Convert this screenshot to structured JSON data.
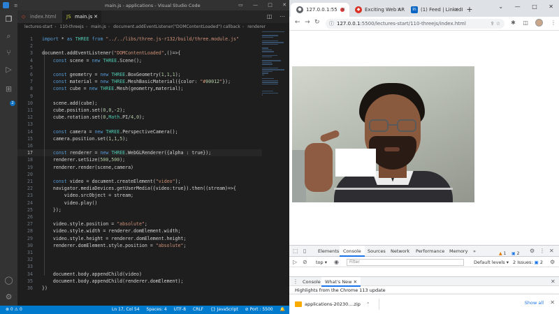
{
  "vscode": {
    "menu": "≡",
    "window_title": "main.js - applications - Visual Studio Code",
    "tabs": [
      {
        "label": "index.html",
        "icon": "html-file-icon"
      },
      {
        "label": "main.js",
        "icon": "js-file-icon"
      }
    ],
    "breadcrumb": [
      "lectures-start",
      "110-threejs",
      "main.js",
      "document.addEventListener(\"DOMContentLoaded\") callback",
      "renderer"
    ],
    "activity_badge": "2",
    "code_lines": [
      {
        "n": "1",
        "t": "import * as THREE from \"../../libs/three.js-r132/build/three.module.js\""
      },
      {
        "n": "2",
        "t": ""
      },
      {
        "n": "3",
        "t": "document.addEventListener(\"DOMContentLoaded\",()=>{"
      },
      {
        "n": "4",
        "t": "    const scene = new THREE.Scene();"
      },
      {
        "n": "5",
        "t": ""
      },
      {
        "n": "6",
        "t": "    const geometry = new THREE.BoxGeometry(1,1,1);"
      },
      {
        "n": "7",
        "t": "    const material = new THREE.MeshBasicMaterial({color: \"#00012\"});"
      },
      {
        "n": "8",
        "t": "    const cube = new THREE.Mesh(geometry,material);"
      },
      {
        "n": "9",
        "t": ""
      },
      {
        "n": "10",
        "t": "    scene.add(cube);"
      },
      {
        "n": "11",
        "t": "    cube.position.set(0,0,-2);"
      },
      {
        "n": "12",
        "t": "    cube.rotation.set(0,Math.PI/4,0);"
      },
      {
        "n": "13",
        "t": ""
      },
      {
        "n": "14",
        "t": "    const camera = new THREE.PerspectiveCamera();"
      },
      {
        "n": "15",
        "t": "    camera.position.set(1,1,5);"
      },
      {
        "n": "16",
        "t": ""
      },
      {
        "n": "17",
        "t": "    const renderer = new THREE.WebGLRenderer({alpha : true});"
      },
      {
        "n": "18",
        "t": "    renderer.setSize(500,500);"
      },
      {
        "n": "19",
        "t": "    renderer.render(scene,camera)"
      },
      {
        "n": "20",
        "t": ""
      },
      {
        "n": "21",
        "t": "    const video = document.createElement(\"video\");"
      },
      {
        "n": "22",
        "t": "    navigator.mediaDevices.getUserMedia({video:true}).then((stream)=>{"
      },
      {
        "n": "23",
        "t": "        video.srcObject = stream;"
      },
      {
        "n": "24",
        "t": "        video.play()"
      },
      {
        "n": "25",
        "t": "    });"
      },
      {
        "n": "26",
        "t": ""
      },
      {
        "n": "27",
        "t": "    video.style.position = \"absolute\";"
      },
      {
        "n": "28",
        "t": "    video.style.width = renderer.domElement.width;"
      },
      {
        "n": "29",
        "t": "    video.style.height = renderer.domElement.height;"
      },
      {
        "n": "30",
        "t": "    renderer.domElement.style.position = \"absolute\";"
      },
      {
        "n": "31",
        "t": ""
      },
      {
        "n": "32",
        "t": ""
      },
      {
        "n": "33",
        "t": ""
      },
      {
        "n": "34",
        "t": "    document.body.appendChild(video)"
      },
      {
        "n": "35",
        "t": "    document.body.appendChild(renderer.domElement);"
      },
      {
        "n": "36",
        "t": "})"
      }
    ],
    "current_line": "17",
    "status": {
      "errors": "⊗ 0 ⚠ 0",
      "position": "Ln 17, Col 54",
      "spaces": "Spaces: 4",
      "encoding": "UTF-8",
      "eol": "CRLF",
      "language": "{} JavaScript",
      "port": "⊘ Port : 5500"
    }
  },
  "chrome": {
    "tabs": [
      {
        "label": "127.0.0.1:55",
        "icon": "globe-icon"
      },
      {
        "label": "Exciting Web AR",
        "icon": "web-icon"
      },
      {
        "label": "(1) Feed | LinkedIn",
        "icon": "linkedin-icon"
      },
      {
        "label": "+"
      }
    ],
    "url_host": "127.0.0.1",
    "url_path": ":5500/lectures-start/110-threejs/index.html",
    "devtools": {
      "tabs": [
        "Elements",
        "Console",
        "Sources",
        "Network",
        "Performance",
        "Memory"
      ],
      "more": "»",
      "warn_count": "1",
      "info_count": "2",
      "context": "top",
      "filter_placeholder": "Filter",
      "levels": "Default levels",
      "issues": "2 Issues:",
      "issues_count": "2",
      "drawer_tabs": [
        "Console",
        "What's New"
      ],
      "whats_new": "Highlights from the Chrome 113 update"
    },
    "download": {
      "file": "applications-20230....zip",
      "show_all": "Show all"
    }
  }
}
